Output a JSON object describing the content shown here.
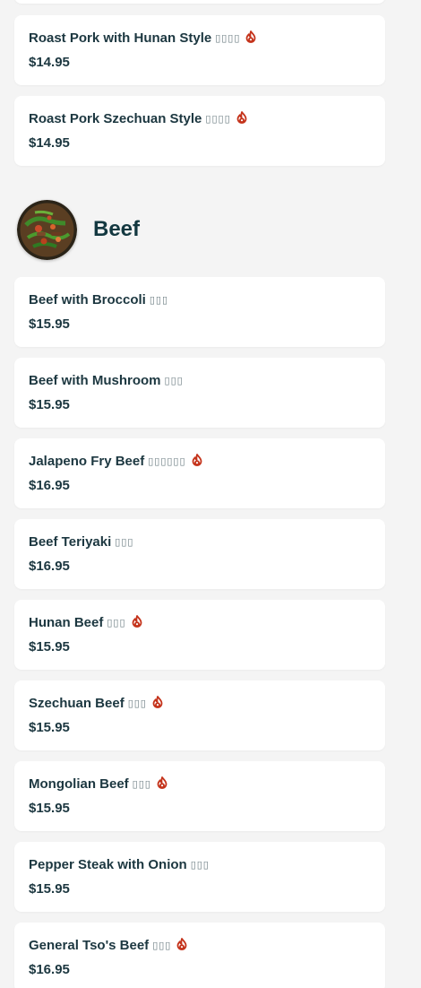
{
  "colors": {
    "background": "#f4f4f4",
    "card": "#ffffff",
    "text": "#1c3740",
    "spicy": "#c4321a"
  },
  "items_top": [
    {
      "name": "Roast Pork with Hunan Style",
      "cjk": "▯▯▯▯",
      "price": "$14.95",
      "spicy": true,
      "icon": "spicy-icon"
    },
    {
      "name": "Roast Pork Szechuan Style",
      "cjk": "▯▯▯▯",
      "price": "$14.95",
      "spicy": true,
      "icon": "spicy-icon"
    }
  ],
  "category": {
    "title": "Beef",
    "image": "beef-dish-photo"
  },
  "items": [
    {
      "name": "Beef with Broccoli",
      "cjk": "▯▯▯",
      "price": "$15.95",
      "spicy": false
    },
    {
      "name": "Beef with Mushroom",
      "cjk": "▯▯▯",
      "price": "$15.95",
      "spicy": false
    },
    {
      "name": "Jalapeno Fry Beef",
      "cjk": "▯▯▯▯▯▯",
      "price": "$16.95",
      "spicy": true
    },
    {
      "name": "Beef Teriyaki",
      "cjk": "▯▯▯",
      "price": "$16.95",
      "spicy": false
    },
    {
      "name": "Hunan Beef",
      "cjk": "▯▯▯",
      "price": "$15.95",
      "spicy": true
    },
    {
      "name": "Szechuan Beef",
      "cjk": "▯▯▯",
      "price": "$15.95",
      "spicy": true
    },
    {
      "name": "Mongolian Beef",
      "cjk": "▯▯▯",
      "price": "$15.95",
      "spicy": true
    },
    {
      "name": "Pepper Steak with Onion",
      "cjk": "▯▯▯",
      "price": "$15.95",
      "spicy": false
    },
    {
      "name": "General Tso's Beef",
      "cjk": "▯▯▯",
      "price": "$16.95",
      "spicy": true
    }
  ]
}
